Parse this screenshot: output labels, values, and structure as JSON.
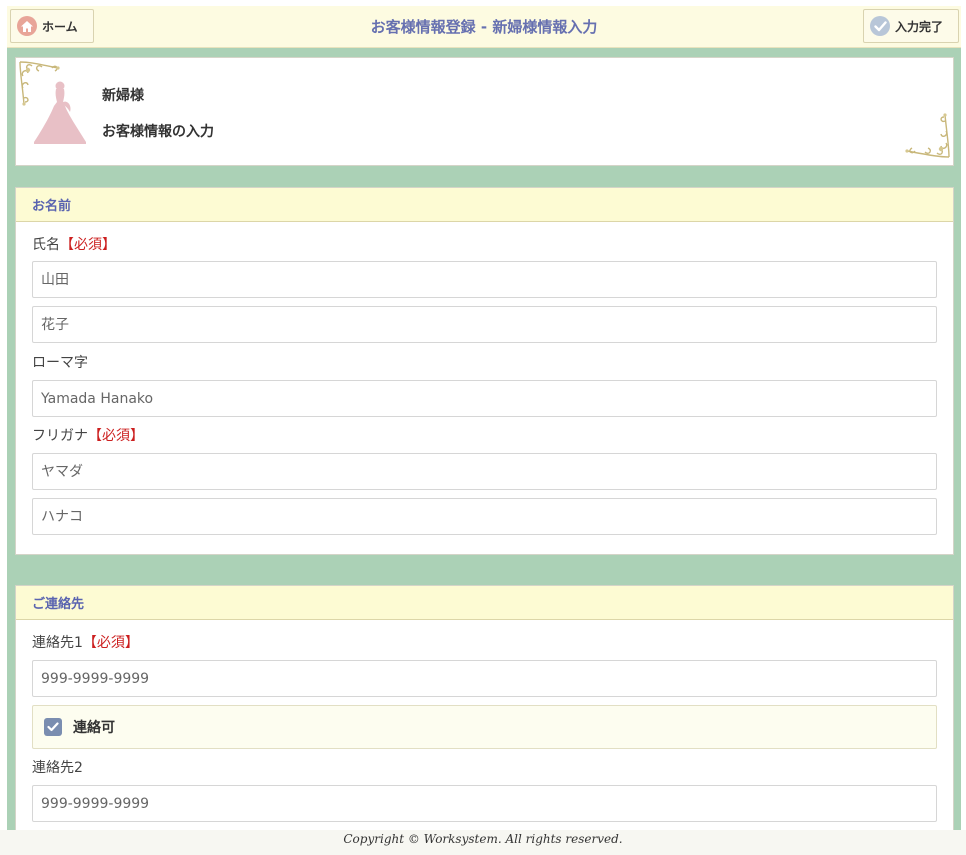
{
  "header": {
    "home_label": "ホーム",
    "title": "お客様情報登録 - 新婦様情報入力",
    "done_label": "入力完了"
  },
  "profile": {
    "line1": "新婦様",
    "line2": "お客様情報の入力"
  },
  "name_section": {
    "heading": "お名前",
    "fullname_label": "氏名",
    "required_tag": "【必須】",
    "last_name_placeholder": "山田",
    "first_name_placeholder": "花子",
    "romaji_label": "ローマ字",
    "romaji_placeholder": "Yamada Hanako",
    "furigana_label": "フリガナ",
    "furigana_last_placeholder": "ヤマダ",
    "furigana_first_placeholder": "ハナコ"
  },
  "contact_section": {
    "heading": "ご連絡先",
    "contact1_label": "連絡先1",
    "required_tag": "【必須】",
    "contact1_placeholder": "999-9999-9999",
    "contactable_label": "連絡可",
    "contactable_checked": true,
    "contact2_label": "連絡先2",
    "contact2_placeholder": "999-9999-9999"
  },
  "footer": {
    "copyright": "Copyright © Worksystem. All rights reserved."
  },
  "colors": {
    "background_green": "#abd1b6",
    "header_cream": "#fdfbe1",
    "title_blue": "#6670b0",
    "required_red": "#cc1f1f"
  }
}
